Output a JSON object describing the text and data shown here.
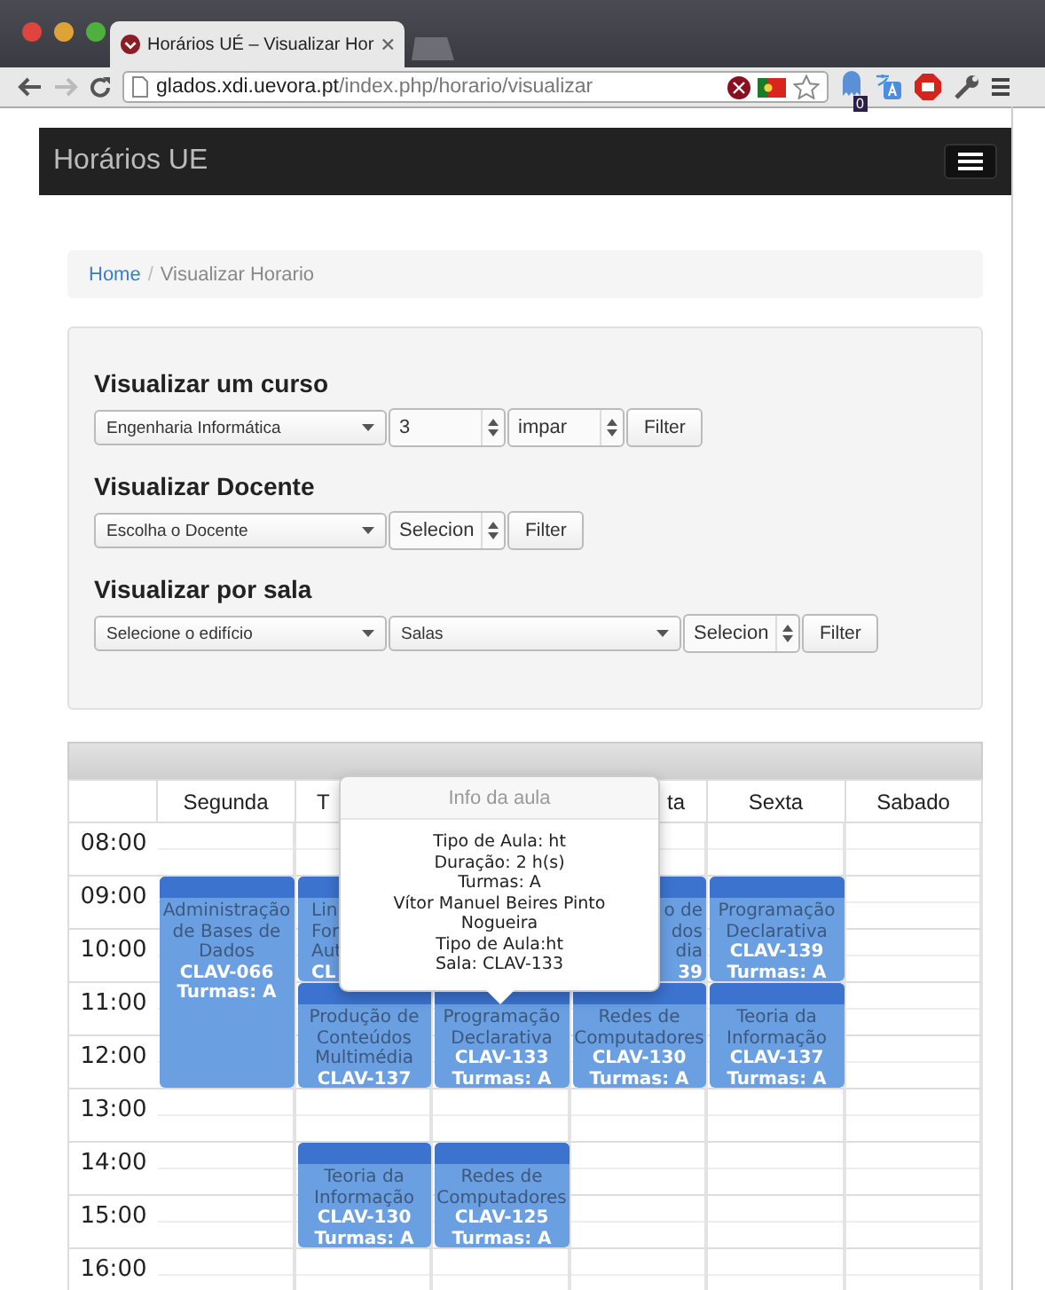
{
  "browser": {
    "tab_title": "Horários UÉ – Visualizar Hor",
    "url_host": "glados.xdi.uevora.pt",
    "url_path": "/index.php/horario/visualizar",
    "forward_disabled": true,
    "extension_badge": "0"
  },
  "navbar": {
    "brand": "Horários UE"
  },
  "breadcrumb": {
    "separator": "/",
    "items": [
      {
        "label": "Home",
        "link": true
      },
      {
        "label": "Visualizar Horario",
        "link": false
      }
    ]
  },
  "filters": [
    {
      "heading": "Visualizar um curso",
      "controls": [
        {
          "kind": "select",
          "value": "Engenharia Informática"
        },
        {
          "kind": "spinner",
          "value": "3"
        },
        {
          "kind": "spinner",
          "value": "impar"
        },
        {
          "kind": "button",
          "value": "Filter"
        }
      ]
    },
    {
      "heading": "Visualizar Docente",
      "controls": [
        {
          "kind": "select",
          "value": "Escolha o Docente"
        },
        {
          "kind": "spinner",
          "value": "Selecion"
        },
        {
          "kind": "button",
          "value": "Filter"
        }
      ]
    },
    {
      "heading": "Visualizar por sala",
      "controls": [
        {
          "kind": "select",
          "value": "Selecione o edifício"
        },
        {
          "kind": "select",
          "value": "Salas"
        },
        {
          "kind": "spinner",
          "value": "Selecion"
        },
        {
          "kind": "button",
          "value": "Filter"
        }
      ]
    }
  ],
  "timetable": {
    "days": [
      {
        "kind": "full",
        "label": "Segunda"
      },
      {
        "kind": "partial_start",
        "label": "T"
      },
      {
        "kind": "covered"
      },
      {
        "kind": "partial_end",
        "label": "ta"
      },
      {
        "kind": "full",
        "label": "Sexta"
      },
      {
        "kind": "full",
        "label": "Sabado"
      }
    ],
    "rows": [
      {
        "time": "08:00",
        "cells": [
          {
            "kind": "empty"
          },
          {
            "kind": "empty"
          },
          {
            "kind": "covered"
          },
          {
            "kind": "empty"
          },
          {
            "kind": "empty"
          },
          {
            "kind": "empty"
          }
        ]
      },
      {
        "time": "09:00",
        "cells": [
          {
            "kind": "class",
            "title_lines": [
              "Administração",
              "de Bases de",
              "Dados"
            ],
            "room": "CLAV-066",
            "turmas": "Turmas: A"
          },
          {
            "kind": "class_partial_start",
            "title_lines": [
              "Lin",
              "For",
              "Aut"
            ],
            "room": "CL"
          },
          {
            "kind": "covered"
          },
          {
            "kind": "class_partial_end",
            "title_lines": [
              "o de",
              "dos",
              "dia"
            ],
            "room": "39"
          },
          {
            "kind": "class",
            "title_lines": [
              "Programação",
              "Declarativa"
            ],
            "room": "CLAV-139",
            "turmas": "Turmas: A"
          },
          {
            "kind": "empty"
          }
        ]
      },
      {
        "time": "10:00",
        "cells": [
          {
            "kind": "continued"
          },
          {
            "kind": "continued"
          },
          {
            "kind": "covered"
          },
          {
            "kind": "continued"
          },
          {
            "kind": "continued"
          },
          {
            "kind": "empty"
          }
        ]
      },
      {
        "time": "11:00",
        "cells": [
          {
            "kind": "continued"
          },
          {
            "kind": "class",
            "title_lines": [
              "Produção de",
              "Conteúdos",
              "Multimédia"
            ],
            "room": "CLAV-137"
          },
          {
            "kind": "class",
            "title_lines": [
              "Programação",
              "Declarativa"
            ],
            "room": "CLAV-133",
            "turmas": "Turmas: A"
          },
          {
            "kind": "class",
            "title_lines": [
              "Redes de",
              "Computadores"
            ],
            "room": "CLAV-130",
            "turmas": "Turmas: A"
          },
          {
            "kind": "class",
            "title_lines": [
              "Teoria da",
              "Informação"
            ],
            "room": "CLAV-137",
            "turmas": "Turmas: A"
          },
          {
            "kind": "empty"
          }
        ]
      },
      {
        "time": "12:00",
        "cells": [
          {
            "kind": "continued"
          },
          {
            "kind": "continued"
          },
          {
            "kind": "continued"
          },
          {
            "kind": "continued"
          },
          {
            "kind": "continued"
          },
          {
            "kind": "empty"
          }
        ]
      },
      {
        "time": "13:00",
        "cells": [
          {
            "kind": "empty"
          },
          {
            "kind": "empty"
          },
          {
            "kind": "empty"
          },
          {
            "kind": "empty"
          },
          {
            "kind": "empty"
          },
          {
            "kind": "empty"
          }
        ]
      },
      {
        "time": "14:00",
        "cells": [
          {
            "kind": "empty"
          },
          {
            "kind": "class",
            "title_lines": [
              "Teoria da",
              "Informação"
            ],
            "room": "CLAV-130",
            "turmas": "Turmas: A"
          },
          {
            "kind": "class",
            "title_lines": [
              "Redes de",
              "Computadores"
            ],
            "room": "CLAV-125",
            "turmas": "Turmas: A"
          },
          {
            "kind": "empty"
          },
          {
            "kind": "empty"
          },
          {
            "kind": "empty"
          }
        ]
      },
      {
        "time": "15:00",
        "cells": [
          {
            "kind": "empty"
          },
          {
            "kind": "continued"
          },
          {
            "kind": "continued"
          },
          {
            "kind": "empty"
          },
          {
            "kind": "empty"
          },
          {
            "kind": "empty"
          }
        ]
      },
      {
        "time": "16:00",
        "cells": [
          {
            "kind": "empty"
          },
          {
            "kind": "empty"
          },
          {
            "kind": "empty"
          },
          {
            "kind": "empty"
          },
          {
            "kind": "empty"
          },
          {
            "kind": "empty"
          }
        ]
      }
    ],
    "popover": {
      "title": "Info da aula",
      "lines": [
        "Tipo de Aula: ht",
        "Duração: 2 h(s)",
        "Turmas: A",
        "Vítor Manuel Beires Pinto Nogueira",
        "Tipo de Aula:ht",
        "Sala: CLAV-133"
      ]
    }
  }
}
